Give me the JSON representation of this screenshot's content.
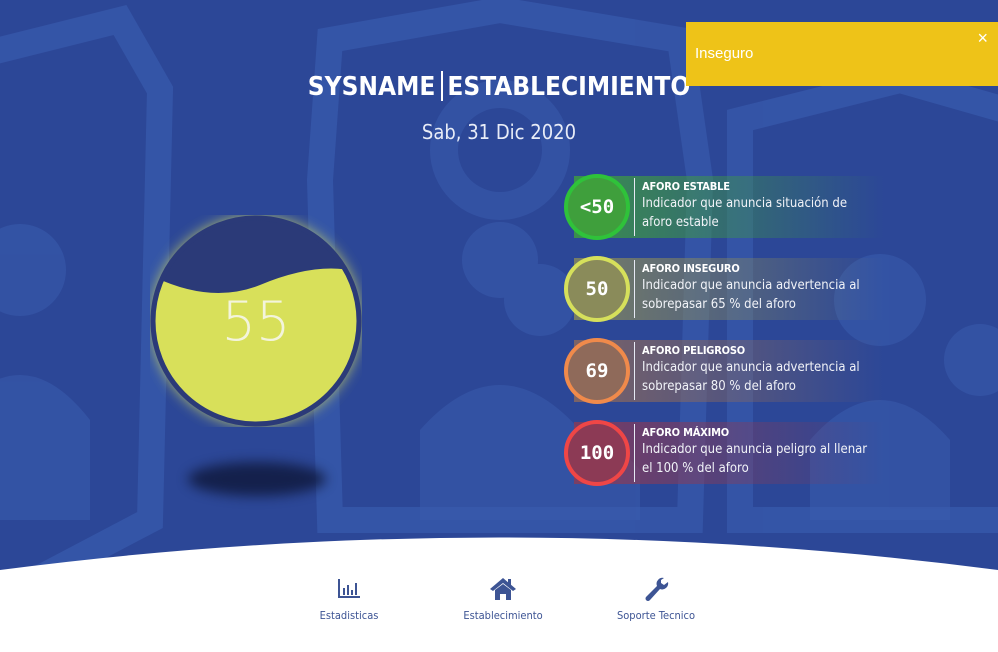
{
  "header": {
    "brand": "SYSNAME",
    "establishment": "ESTABLECIMIENTO",
    "date": "Sab, 31 Dic 2020"
  },
  "gauge": {
    "value": "55",
    "fill_fraction": 0.72,
    "fill_color": "#d8e05a",
    "ring_color": "#2b3a78"
  },
  "legend": [
    {
      "value": "<50",
      "title": "AFORO ESTABLE",
      "description": "Indicador que anuncia situación de aforo estable",
      "color": "#3f9f3c",
      "ring": "#2fc23a"
    },
    {
      "value": "50",
      "title": "AFORO INSEGURO",
      "description": "Indicador que anuncia advertencia al sobrepasar 65 % del aforo",
      "color": "#8a8b5a",
      "ring": "#d6e05b"
    },
    {
      "value": "69",
      "title": "AFORO PELIGROSO",
      "description": "Indicador que anuncia advertencia al sobrepasar 80 % del aforo",
      "color": "#8f6a5a",
      "ring": "#f08a4b"
    },
    {
      "value": "100",
      "title": "AFORO MÁXIMO",
      "description": "Indicador que anuncia peligro al llenar el 100 % del aforo",
      "color": "#8c3a55",
      "ring": "#ef4646"
    }
  ],
  "toast": {
    "message": "Inseguro",
    "close_label": "×",
    "color": "#eec318"
  },
  "nav": [
    {
      "label": "Estadisticas",
      "icon": "bar-chart-icon"
    },
    {
      "label": "Establecimiento",
      "icon": "home-icon"
    },
    {
      "label": "Soporte Tecnico",
      "icon": "wrench-icon"
    }
  ],
  "colors": {
    "background": "#2c4797",
    "nav_accent": "#3d5494"
  }
}
